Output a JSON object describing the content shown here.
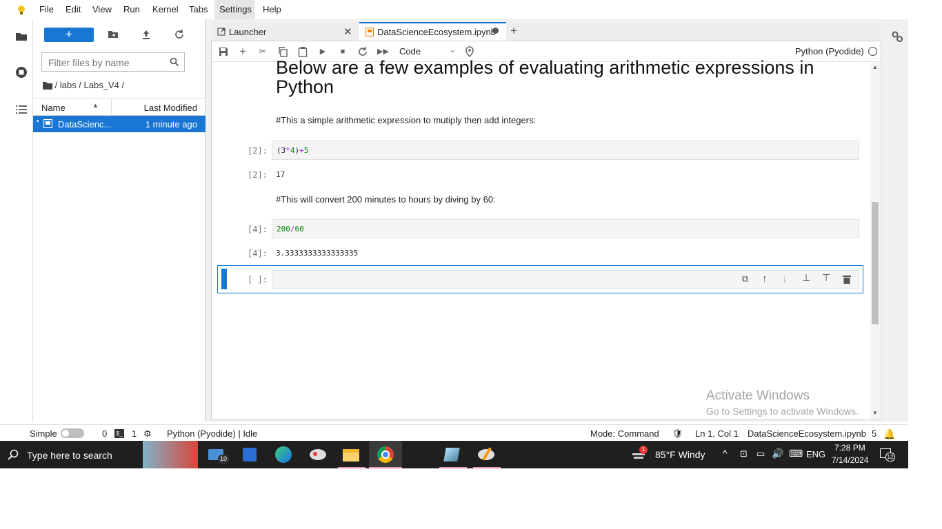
{
  "menubar": {
    "items": [
      "File",
      "Edit",
      "View",
      "Run",
      "Kernel",
      "Tabs",
      "Settings",
      "Help"
    ],
    "active": "Settings"
  },
  "filebrowser": {
    "new_label": "+",
    "filter_placeholder": "Filter files by name",
    "breadcrumb": "/ labs / Labs_V4 /",
    "col_name": "Name",
    "col_modified": "Last Modified",
    "files": [
      {
        "name": "DataScienc...",
        "modified": "1 minute ago"
      }
    ]
  },
  "tabs": [
    {
      "label": "Launcher"
    },
    {
      "label": "DataScienceEcosystem.ipynb"
    }
  ],
  "toolbar": {
    "cell_type": "Code",
    "kernel": "Python (Pyodide)"
  },
  "notebook": {
    "heading": "Below are a few examples of evaluating arithmetic expressions in Python",
    "md1": "#This a simple arithmetic expression to mutiply then add integers:",
    "cell1_prompt": "[2]:",
    "cell1_code_a": "(3",
    "cell1_code_op1": "*",
    "cell1_code_b": "4",
    "cell1_code_c": ")",
    "cell1_code_op2": "+",
    "cell1_code_d": "5",
    "out1_prompt": "[2]:",
    "out1": "17",
    "md2": "#This will convert 200 minutes to hours by diving by 60:",
    "cell2_prompt": "[4]:",
    "cell2_code_a": "200",
    "cell2_code_op": "/",
    "cell2_code_b": "60",
    "out2_prompt": "[4]:",
    "out2": "3.3333333333333335",
    "cell3_prompt": "[ ]:"
  },
  "watermark": {
    "title": "Activate Windows",
    "subtitle": "Go to Settings to activate Windows."
  },
  "statusbar": {
    "mode_simple": "Simple",
    "terminals": "0",
    "kernels": "1",
    "kernel_status": "Python (Pyodide) | Idle",
    "mode": "Mode: Command",
    "position": "Ln 1, Col 1",
    "filename": "DataScienceEcosystem.ipynb",
    "notifications": "5"
  },
  "taskbar": {
    "search_placeholder": "Type here to search",
    "mail_badge": "10",
    "weather_badge": "1",
    "weather": "85°F  Windy",
    "lang": "ENG",
    "time": "7:28 PM",
    "date": "7/14/2024",
    "notif_count": "12"
  },
  "colors": {
    "accent": "#1976d2",
    "taskbar": "#1f1f1f",
    "code_number": "#008000",
    "code_operator": "#aa22ff"
  }
}
